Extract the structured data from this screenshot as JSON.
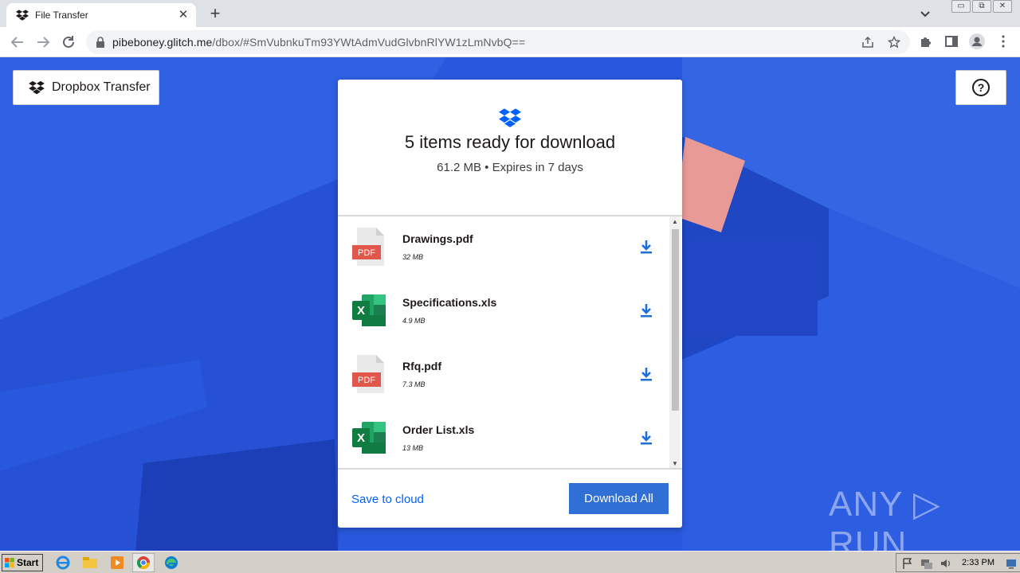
{
  "browser": {
    "tab_title": "File Transfer",
    "tab_close": "✕",
    "new_tab": "+",
    "url_host": "pibeboney.glitch.me",
    "url_rest": "/dbox/#SmVubnkuTm93YWtAdmVudGlvbnRlYW1zLmNvbQ==",
    "window_buttons": [
      "▭",
      "⧉",
      "✕"
    ]
  },
  "page": {
    "brand_label": "Dropbox Transfer",
    "help_label": "?",
    "card": {
      "title": "5 items ready for download",
      "subtitle": "61.2 MB • Expires in 7 days",
      "files": [
        {
          "name": "Drawings.pdf",
          "size": "32 MB",
          "type": "pdf",
          "badge": "PDF"
        },
        {
          "name": "Specifications.xls",
          "size": "4.9 MB",
          "type": "xls",
          "badge": "X"
        },
        {
          "name": "Rfq.pdf",
          "size": "7.3 MB",
          "type": "pdf",
          "badge": "PDF"
        },
        {
          "name": "Order List.xls",
          "size": "13 MB",
          "type": "xls",
          "badge": "X"
        }
      ],
      "scroll_up": "▲",
      "scroll_down": "▼",
      "save_to_cloud": "Save to cloud",
      "download_all": "Download All"
    },
    "watermark": "ANY ▷ RUN"
  },
  "taskbar": {
    "start_label": "Start",
    "clock": "2:33 PM"
  },
  "colors": {
    "dropbox_blue": "#0061fe",
    "button_blue": "#2f6fd6",
    "pdf_red": "#e2574c",
    "excel_green": "#1d6f42",
    "page_bg": "#2858dd"
  }
}
